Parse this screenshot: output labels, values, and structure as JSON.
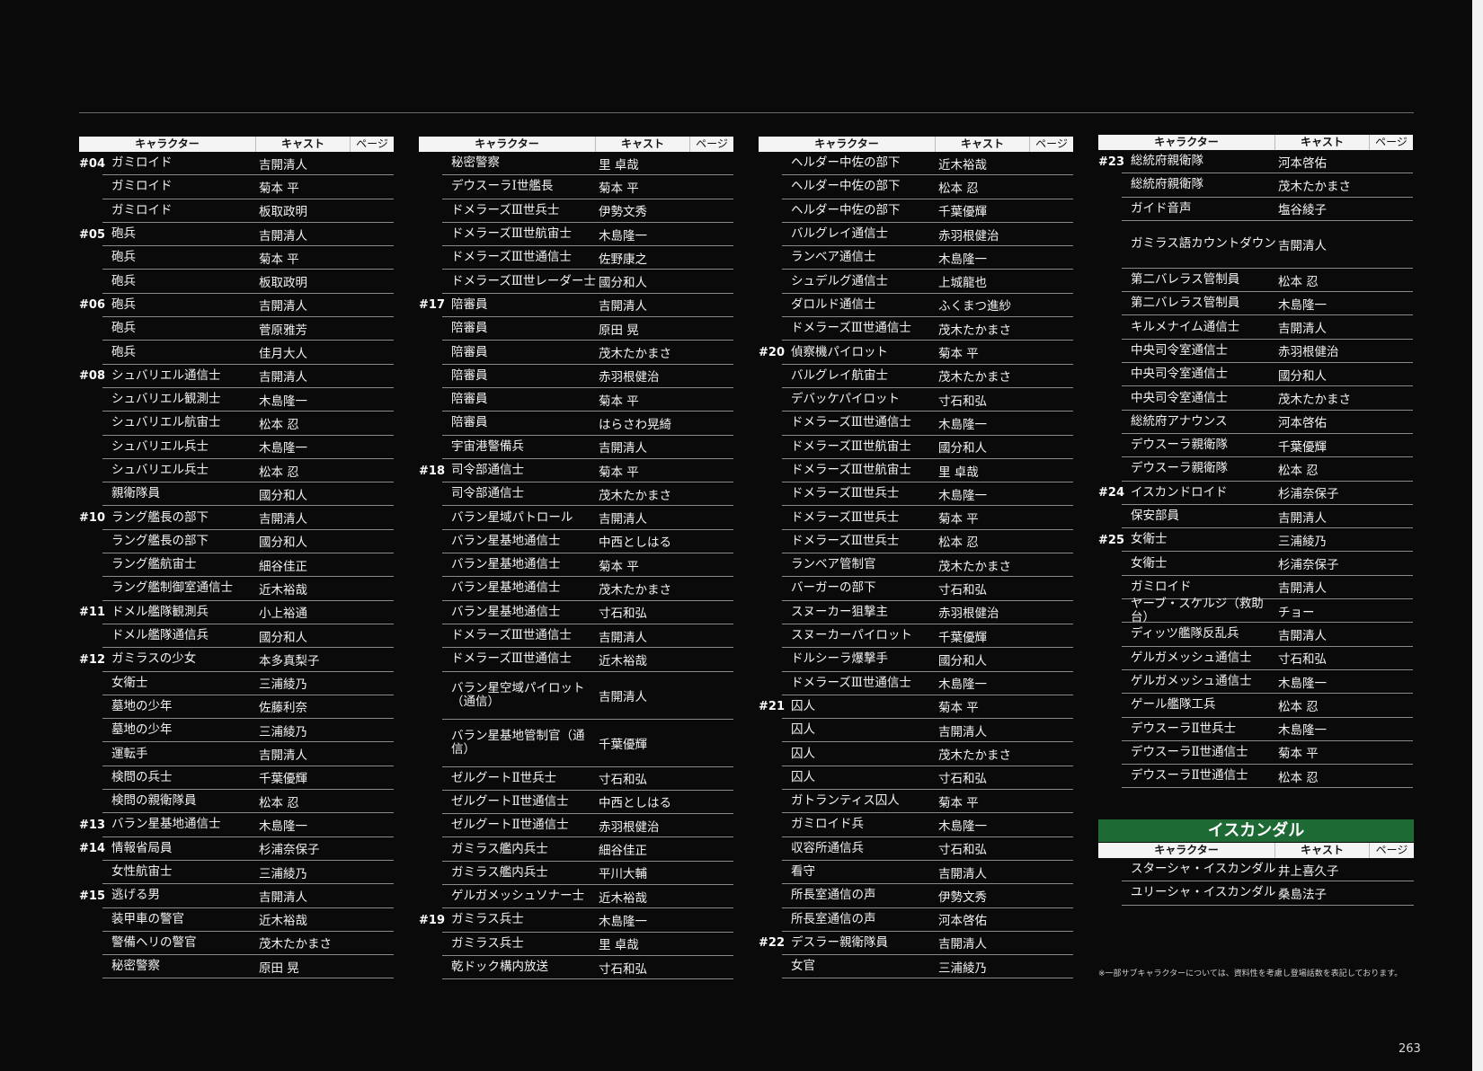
{
  "headers": {
    "character": "キャラクター",
    "cast": "キャスト",
    "page": "ページ"
  },
  "columns": [
    {
      "rows": [
        {
          "ep": "#04",
          "character": "ガミロイド",
          "cast": "吉開清人"
        },
        {
          "ep": "",
          "character": "ガミロイド",
          "cast": "菊本 平"
        },
        {
          "ep": "",
          "character": "ガミロイド",
          "cast": "板取政明"
        },
        {
          "ep": "#05",
          "character": "砲兵",
          "cast": "吉開清人"
        },
        {
          "ep": "",
          "character": "砲兵",
          "cast": "菊本 平"
        },
        {
          "ep": "",
          "character": "砲兵",
          "cast": "板取政明"
        },
        {
          "ep": "#06",
          "character": "砲兵",
          "cast": "吉開清人"
        },
        {
          "ep": "",
          "character": "砲兵",
          "cast": "菅原雅芳"
        },
        {
          "ep": "",
          "character": "砲兵",
          "cast": "佳月大人"
        },
        {
          "ep": "#08",
          "character": "シュバリエル通信士",
          "cast": "吉開清人"
        },
        {
          "ep": "",
          "character": "シュバリエル観測士",
          "cast": "木島隆一"
        },
        {
          "ep": "",
          "character": "シュバリエル航宙士",
          "cast": "松本 忍"
        },
        {
          "ep": "",
          "character": "シュバリエル兵士",
          "cast": "木島隆一"
        },
        {
          "ep": "",
          "character": "シュバリエル兵士",
          "cast": "松本 忍"
        },
        {
          "ep": "",
          "character": "親衛隊員",
          "cast": "國分和人"
        },
        {
          "ep": "#10",
          "character": "ラング艦長の部下",
          "cast": "吉開清人"
        },
        {
          "ep": "",
          "character": "ラング艦長の部下",
          "cast": "國分和人"
        },
        {
          "ep": "",
          "character": "ラング艦航宙士",
          "cast": "細谷佳正"
        },
        {
          "ep": "",
          "character": "ラング艦制御室通信士",
          "cast": "近木裕哉"
        },
        {
          "ep": "#11",
          "character": "ドメル艦隊観測兵",
          "cast": "小上裕通"
        },
        {
          "ep": "",
          "character": "ドメル艦隊通信兵",
          "cast": "國分和人"
        },
        {
          "ep": "#12",
          "character": "ガミラスの少女",
          "cast": "本多真梨子"
        },
        {
          "ep": "",
          "character": "女衛士",
          "cast": "三浦綾乃"
        },
        {
          "ep": "",
          "character": "墓地の少年",
          "cast": "佐藤利奈"
        },
        {
          "ep": "",
          "character": "墓地の少年",
          "cast": "三浦綾乃"
        },
        {
          "ep": "",
          "character": "運転手",
          "cast": "吉開清人"
        },
        {
          "ep": "",
          "character": "検問の兵士",
          "cast": "千葉優輝"
        },
        {
          "ep": "",
          "character": "検問の親衛隊員",
          "cast": "松本 忍"
        },
        {
          "ep": "#13",
          "character": "バラン星基地通信士",
          "cast": "木島隆一"
        },
        {
          "ep": "#14",
          "character": "情報省局員",
          "cast": "杉浦奈保子"
        },
        {
          "ep": "",
          "character": "女性航宙士",
          "cast": "三浦綾乃"
        },
        {
          "ep": "#15",
          "character": "逃げる男",
          "cast": "吉開清人"
        },
        {
          "ep": "",
          "character": "装甲車の警官",
          "cast": "近木裕哉"
        },
        {
          "ep": "",
          "character": "警備ヘリの警官",
          "cast": "茂木たかまさ"
        },
        {
          "ep": "",
          "character": "秘密警察",
          "cast": "原田 晃"
        }
      ]
    },
    {
      "rows": [
        {
          "ep": "",
          "character": "秘密警察",
          "cast": "里 卓哉"
        },
        {
          "ep": "",
          "character": "デウスーラⅠ世艦長",
          "cast": "菊本 平"
        },
        {
          "ep": "",
          "character": "ドメラーズⅢ世兵士",
          "cast": "伊勢文秀"
        },
        {
          "ep": "",
          "character": "ドメラーズⅢ世航宙士",
          "cast": "木島隆一"
        },
        {
          "ep": "",
          "character": "ドメラーズⅢ世通信士",
          "cast": "佐野康之"
        },
        {
          "ep": "",
          "character": "ドメラーズⅢ世レーダー士",
          "cast": "國分和人"
        },
        {
          "ep": "#17",
          "character": "陪審員",
          "cast": "吉開清人"
        },
        {
          "ep": "",
          "character": "陪審員",
          "cast": "原田 晃"
        },
        {
          "ep": "",
          "character": "陪審員",
          "cast": "茂木たかまさ"
        },
        {
          "ep": "",
          "character": "陪審員",
          "cast": "赤羽根健治"
        },
        {
          "ep": "",
          "character": "陪審員",
          "cast": "菊本 平"
        },
        {
          "ep": "",
          "character": "陪審員",
          "cast": "はらさわ晃綺"
        },
        {
          "ep": "",
          "character": "宇宙港警備兵",
          "cast": "吉開清人"
        },
        {
          "ep": "#18",
          "character": "司令部通信士",
          "cast": "菊本 平"
        },
        {
          "ep": "",
          "character": "司令部通信士",
          "cast": "茂木たかまさ"
        },
        {
          "ep": "",
          "character": "バラン星域パトロール",
          "cast": "吉開清人"
        },
        {
          "ep": "",
          "character": "バラン星基地通信士",
          "cast": "中西としはる"
        },
        {
          "ep": "",
          "character": "バラン星基地通信士",
          "cast": "菊本 平"
        },
        {
          "ep": "",
          "character": "バラン星基地通信士",
          "cast": "茂木たかまさ"
        },
        {
          "ep": "",
          "character": "バラン星基地通信士",
          "cast": "寸石和弘"
        },
        {
          "ep": "",
          "character": "ドメラーズⅢ世通信士",
          "cast": "吉開清人"
        },
        {
          "ep": "",
          "character": "ドメラーズⅢ世通信士",
          "cast": "近木裕哉"
        },
        {
          "ep": "",
          "character": "バラン星空域パイロット（通信）",
          "cast": "吉開清人",
          "tall": true
        },
        {
          "ep": "",
          "character": "バラン星基地管制官（通信）",
          "cast": "千葉優輝",
          "tall": true
        },
        {
          "ep": "",
          "character": "ゼルグートⅡ世兵士",
          "cast": "寸石和弘"
        },
        {
          "ep": "",
          "character": "ゼルグートⅡ世通信士",
          "cast": "中西としはる"
        },
        {
          "ep": "",
          "character": "ゼルグートⅡ世通信士",
          "cast": "赤羽根健治"
        },
        {
          "ep": "",
          "character": "ガミラス艦内兵士",
          "cast": "細谷佳正"
        },
        {
          "ep": "",
          "character": "ガミラス艦内兵士",
          "cast": "平川大輔"
        },
        {
          "ep": "",
          "character": "ゲルガメッシュソナー士",
          "cast": "近木裕哉"
        },
        {
          "ep": "#19",
          "character": "ガミラス兵士",
          "cast": "木島隆一"
        },
        {
          "ep": "",
          "character": "ガミラス兵士",
          "cast": "里 卓哉"
        },
        {
          "ep": "",
          "character": "乾ドック構内放送",
          "cast": "寸石和弘"
        }
      ]
    },
    {
      "rows": [
        {
          "ep": "",
          "character": "ヘルダー中佐の部下",
          "cast": "近木裕哉"
        },
        {
          "ep": "",
          "character": "ヘルダー中佐の部下",
          "cast": "松本 忍"
        },
        {
          "ep": "",
          "character": "ヘルダー中佐の部下",
          "cast": "千葉優輝"
        },
        {
          "ep": "",
          "character": "バルグレイ通信士",
          "cast": "赤羽根健治"
        },
        {
          "ep": "",
          "character": "ランベア通信士",
          "cast": "木島隆一"
        },
        {
          "ep": "",
          "character": "シュデルグ通信士",
          "cast": "上城龍也"
        },
        {
          "ep": "",
          "character": "ダロルド通信士",
          "cast": "ふくまつ進紗"
        },
        {
          "ep": "",
          "character": "ドメラーズⅢ世通信士",
          "cast": "茂木たかまさ"
        },
        {
          "ep": "#20",
          "character": "偵察機パイロット",
          "cast": "菊本 平"
        },
        {
          "ep": "",
          "character": "バルグレイ航宙士",
          "cast": "茂木たかまさ"
        },
        {
          "ep": "",
          "character": "デバッケパイロット",
          "cast": "寸石和弘"
        },
        {
          "ep": "",
          "character": "ドメラーズⅢ世通信士",
          "cast": "木島隆一"
        },
        {
          "ep": "",
          "character": "ドメラーズⅢ世航宙士",
          "cast": "國分和人"
        },
        {
          "ep": "",
          "character": "ドメラーズⅢ世航宙士",
          "cast": "里 卓哉"
        },
        {
          "ep": "",
          "character": "ドメラーズⅢ世兵士",
          "cast": "木島隆一"
        },
        {
          "ep": "",
          "character": "ドメラーズⅢ世兵士",
          "cast": "菊本 平"
        },
        {
          "ep": "",
          "character": "ドメラーズⅢ世兵士",
          "cast": "松本 忍"
        },
        {
          "ep": "",
          "character": "ランベア管制官",
          "cast": "茂木たかまさ"
        },
        {
          "ep": "",
          "character": "バーガーの部下",
          "cast": "寸石和弘"
        },
        {
          "ep": "",
          "character": "スヌーカー狙撃主",
          "cast": "赤羽根健治"
        },
        {
          "ep": "",
          "character": "スヌーカーパイロット",
          "cast": "千葉優輝"
        },
        {
          "ep": "",
          "character": "ドルシーラ爆撃手",
          "cast": "國分和人"
        },
        {
          "ep": "",
          "character": "ドメラーズⅢ世通信士",
          "cast": "木島隆一"
        },
        {
          "ep": "#21",
          "character": "囚人",
          "cast": "菊本 平"
        },
        {
          "ep": "",
          "character": "囚人",
          "cast": "吉開清人"
        },
        {
          "ep": "",
          "character": "囚人",
          "cast": "茂木たかまさ"
        },
        {
          "ep": "",
          "character": "囚人",
          "cast": "寸石和弘"
        },
        {
          "ep": "",
          "character": "ガトランティス囚人",
          "cast": "菊本 平"
        },
        {
          "ep": "",
          "character": "ガミロイド兵",
          "cast": "木島隆一"
        },
        {
          "ep": "",
          "character": "収容所通信兵",
          "cast": "寸石和弘"
        },
        {
          "ep": "",
          "character": "看守",
          "cast": "吉開清人"
        },
        {
          "ep": "",
          "character": "所長室通信の声",
          "cast": "伊勢文秀"
        },
        {
          "ep": "",
          "character": "所長室通信の声",
          "cast": "河本啓佑"
        },
        {
          "ep": "#22",
          "character": "デスラー親衛隊員",
          "cast": "吉開清人"
        },
        {
          "ep": "",
          "character": "女官",
          "cast": "三浦綾乃"
        }
      ]
    },
    {
      "rows": [
        {
          "ep": "#23",
          "character": "総統府親衛隊",
          "cast": "河本啓佑"
        },
        {
          "ep": "",
          "character": "総統府親衛隊",
          "cast": "茂木たかまさ"
        },
        {
          "ep": "",
          "character": "ガイド音声",
          "cast": "塩谷綾子"
        },
        {
          "ep": "",
          "character": "ガミラス語カウントダウン",
          "cast": "吉開清人",
          "tall": true
        },
        {
          "ep": "",
          "character": "第二バレラス管制員",
          "cast": "松本 忍"
        },
        {
          "ep": "",
          "character": "第二バレラス管制員",
          "cast": "木島隆一"
        },
        {
          "ep": "",
          "character": "キルメナイム通信士",
          "cast": "吉開清人"
        },
        {
          "ep": "",
          "character": "中央司令室通信士",
          "cast": "赤羽根健治"
        },
        {
          "ep": "",
          "character": "中央司令室通信士",
          "cast": "國分和人"
        },
        {
          "ep": "",
          "character": "中央司令室通信士",
          "cast": "茂木たかまさ"
        },
        {
          "ep": "",
          "character": "総統府アナウンス",
          "cast": "河本啓佑"
        },
        {
          "ep": "",
          "character": "デウスーラ親衛隊",
          "cast": "千葉優輝"
        },
        {
          "ep": "",
          "character": "デウスーラ親衛隊",
          "cast": "松本 忍"
        },
        {
          "ep": "#24",
          "character": "イスカンドロイド",
          "cast": "杉浦奈保子"
        },
        {
          "ep": "",
          "character": "保安部員",
          "cast": "吉開清人"
        },
        {
          "ep": "#25",
          "character": "女衛士",
          "cast": "三浦綾乃"
        },
        {
          "ep": "",
          "character": "女衛士",
          "cast": "杉浦奈保子"
        },
        {
          "ep": "",
          "character": "ガミロイド",
          "cast": "吉開清人"
        },
        {
          "ep": "",
          "character": "ヤーブ・スケルジ（救助台）",
          "cast": "チョー"
        },
        {
          "ep": "",
          "character": "ディッツ艦隊反乱兵",
          "cast": "吉開清人"
        },
        {
          "ep": "",
          "character": "ゲルガメッシュ通信士",
          "cast": "寸石和弘"
        },
        {
          "ep": "",
          "character": "ゲルガメッシュ通信士",
          "cast": "木島隆一"
        },
        {
          "ep": "",
          "character": "ゲール艦隊工兵",
          "cast": "松本 忍"
        },
        {
          "ep": "",
          "character": "デウスーラⅡ世兵士",
          "cast": "木島隆一"
        },
        {
          "ep": "",
          "character": "デウスーラⅡ世通信士",
          "cast": "菊本 平"
        },
        {
          "ep": "",
          "character": "デウスーラⅡ世通信士",
          "cast": "松本 忍"
        }
      ]
    }
  ],
  "iscandar": {
    "title": "イスカンダル",
    "rows": [
      {
        "character": "スターシャ・イスカンダル",
        "cast": "井上喜久子"
      },
      {
        "character": "ユリーシャ・イスカンダル",
        "cast": "桑島法子"
      }
    ]
  },
  "footnote": "※一部サブキャラクターについては、資料性を考慮し登場話数を表記しております。",
  "page_number": "263"
}
